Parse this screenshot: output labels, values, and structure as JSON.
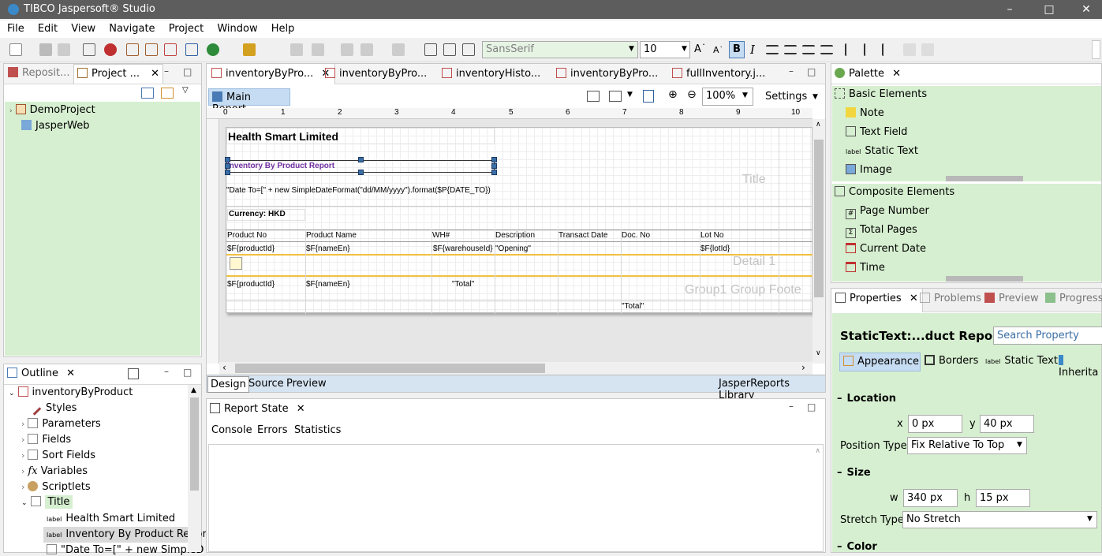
{
  "app": {
    "title": "TIBCO Jaspersoft® Studio"
  },
  "menu": [
    "File",
    "Edit",
    "View",
    "Navigate",
    "Project",
    "Window",
    "Help"
  ],
  "toolbar": {
    "font": "SansSerif",
    "size": "10"
  },
  "left_top": {
    "tabs": [
      "Reposit...",
      "Project ..."
    ],
    "tree": [
      "DemoProject",
      "JasperWeb"
    ]
  },
  "editor_tabs": [
    "inventoryByPro...",
    "inventoryByPro...",
    "inventoryHisto...",
    "inventoryByPro...",
    "fullInventory.j..."
  ],
  "editor": {
    "main_report": "Main Report",
    "zoom": "100%",
    "settings": "Settings",
    "ruler": [
      "0",
      "1",
      "2",
      "3",
      "4",
      "5",
      "6",
      "7",
      "8",
      "9",
      "10"
    ],
    "bottom_tabs": [
      "Design",
      "Source",
      "Preview"
    ],
    "library": "JasperReports Library"
  },
  "report": {
    "title": "Health Smart Limited",
    "subtitle": "Inventory By Product Report",
    "date_expr": "\"Date To=[\" + new SimpleDateFormat(\"dd/MM/yyyy\").format($P{DATE_TO})",
    "currency": "Currency: HKD",
    "headers": [
      "Product No",
      "Product Name",
      "WH#",
      "Description",
      "Transact Date",
      "Doc. No",
      "Lot No"
    ],
    "row1": [
      "$F{productId}",
      "$F{nameEn}",
      "$F{warehouseId}",
      "\"Opening\"",
      "$F{lotId}"
    ],
    "row2": [
      "$F{productId}",
      "$F{nameEn}",
      "\"Total\""
    ],
    "total": "\"Total\"",
    "bands": {
      "title": "Title",
      "detail": "Detail 1",
      "group_footer": "Group1 Group Foote"
    }
  },
  "outline": {
    "title": "Outline",
    "root": "inventoryByProduct",
    "items": [
      "Styles",
      "Parameters",
      "Fields",
      "Sort Fields",
      "Variables",
      "Scriptlets",
      "Title"
    ],
    "children": [
      "Health Smart Limited",
      "Inventory By Product Repor",
      "\"Date To=[\" + new SimpleD"
    ]
  },
  "report_state": {
    "title": "Report State",
    "tabs": [
      "Console",
      "Errors",
      "Statistics"
    ]
  },
  "palette": {
    "title": "Palette",
    "basic": "Basic Elements",
    "basic_items": [
      "Note",
      "Text Field",
      "Static Text",
      "Image"
    ],
    "composite": "Composite Elements",
    "composite_items": [
      "Page Number",
      "Total Pages",
      "Current Date",
      "Time"
    ]
  },
  "properties": {
    "tabs": [
      "Properties",
      "Problems",
      "Preview",
      "Progress"
    ],
    "element": "StaticText:...duct Report",
    "search": "Search Property",
    "subtabs": [
      "Appearance",
      "Borders",
      "Static Text",
      "Inherita"
    ],
    "location": "Location",
    "x_label": "x",
    "x": "0 px",
    "y_label": "y",
    "y": "40 px",
    "position_type_label": "Position Type",
    "position_type": "Fix Relative To Top",
    "size": "Size",
    "w_label": "w",
    "w": "340 px",
    "h_label": "h",
    "h": "15 px",
    "stretch_label": "Stretch Type",
    "stretch": "No Stretch",
    "color": "Color"
  }
}
